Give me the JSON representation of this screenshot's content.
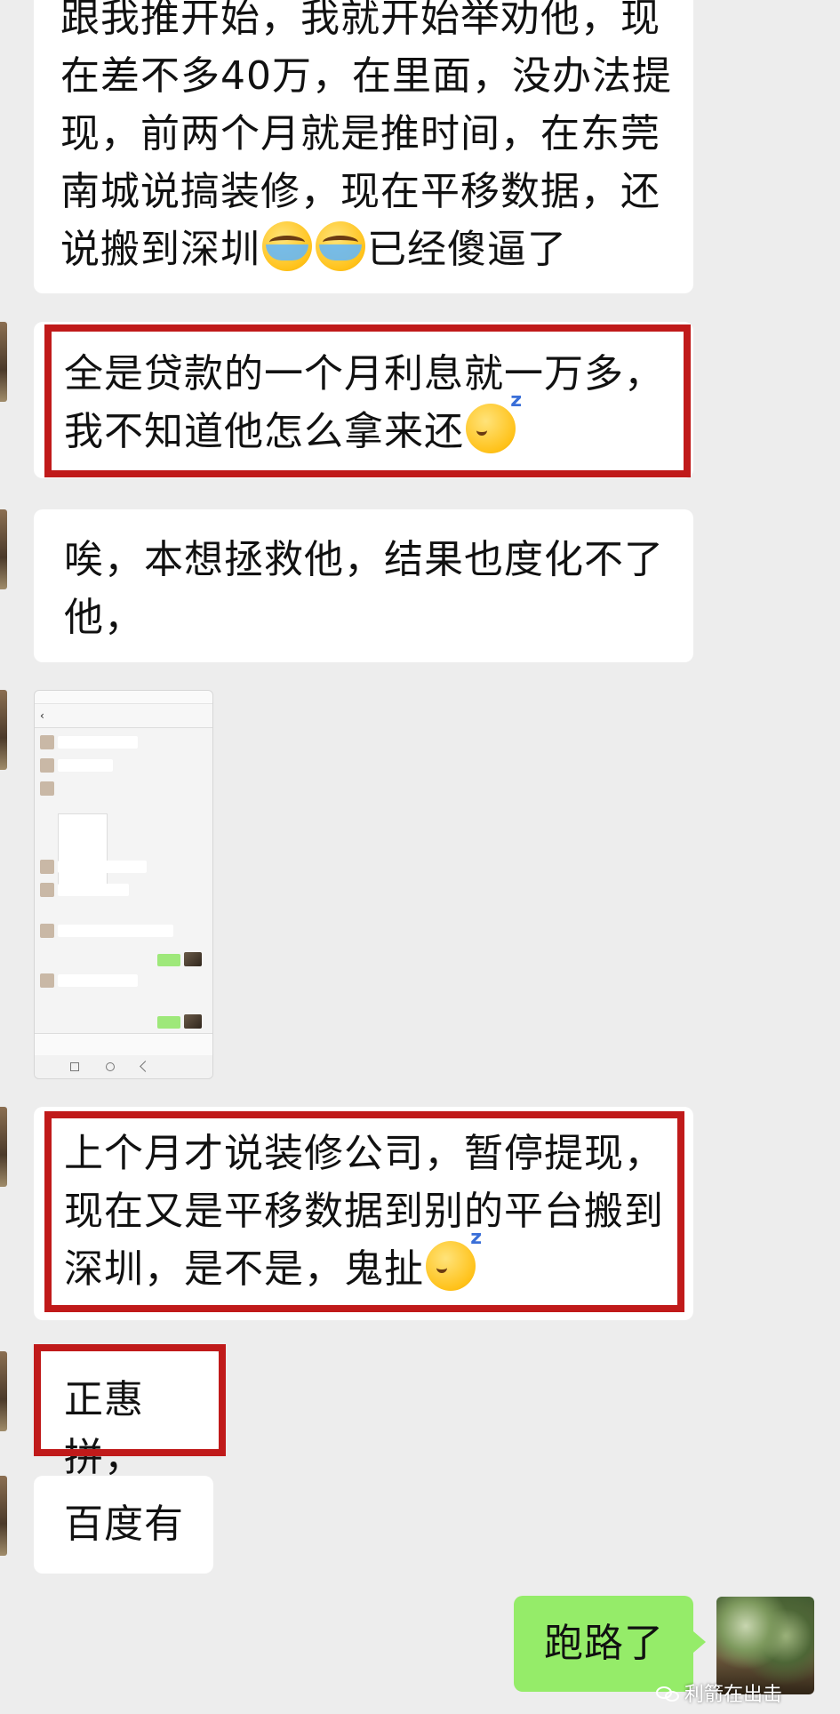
{
  "messages": {
    "m1": {
      "line1": "跟我推开始，我就开始举劝他，现",
      "line2": "在差不多40万，在里面，没办法提",
      "line3": "现，前两个月就是推时间，在东莞",
      "line4": "南城说搞装修，现在平移数据，还",
      "line5a": "说搬到深圳",
      "line5b": "已经傻逼了",
      "emoji": "crying-face-emoji"
    },
    "m2": {
      "line1": "全是贷款的一个月利息就一万多，",
      "line2": "我不知道他怎么拿来还",
      "emoji": "sleeping-face-emoji"
    },
    "m3": {
      "line1": "唉，本想拯救他，结果也度化不了",
      "line2": "他，"
    },
    "m5": {
      "line1": "上个月才说装修公司，暂停提现，",
      "line2": "现在又是平移数据到别的平台搬到",
      "line3": "深圳，是不是，鬼扯",
      "emoji": "sleeping-face-emoji"
    },
    "m6": {
      "text": "正惠拼，"
    },
    "m7": {
      "text": "百度有"
    },
    "m8": {
      "text": "跑路了"
    }
  },
  "watermark": {
    "text": "利箭在出击",
    "icon": "wechat-icon"
  },
  "colors": {
    "background": "#ededed",
    "incoming_bubble": "#ffffff",
    "outgoing_bubble": "#95ec69",
    "highlight_border": "#c01a1a"
  }
}
